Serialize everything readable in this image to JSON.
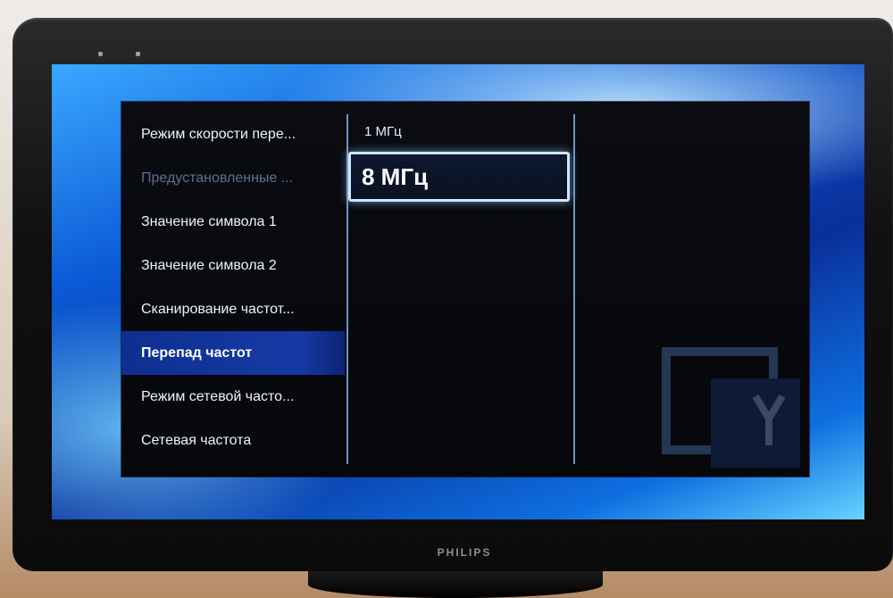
{
  "tv": {
    "brand": "PHILIPS"
  },
  "menu": {
    "items": [
      {
        "label": "Режим скорости пере...",
        "state": "normal"
      },
      {
        "label": "Предустановленные ...",
        "state": "disabled"
      },
      {
        "label": "Значение символа 1",
        "state": "normal"
      },
      {
        "label": "Значение символа 2",
        "state": "normal"
      },
      {
        "label": "Сканирование частот...",
        "state": "normal"
      },
      {
        "label": "Перепад частот",
        "state": "selected"
      },
      {
        "label": "Режим сетевой часто...",
        "state": "normal"
      },
      {
        "label": "Сетевая частота",
        "state": "normal"
      }
    ]
  },
  "options": {
    "items": [
      {
        "label": "1 МГц",
        "state": "normal"
      },
      {
        "label": "8 МГц",
        "state": "focused"
      }
    ]
  },
  "colors": {
    "selection": "#153aa6",
    "focus_border": "#cfe6ff",
    "screen_blue": "#0b5ad6"
  },
  "icons": {
    "decoration": "tv-logo-icon"
  }
}
